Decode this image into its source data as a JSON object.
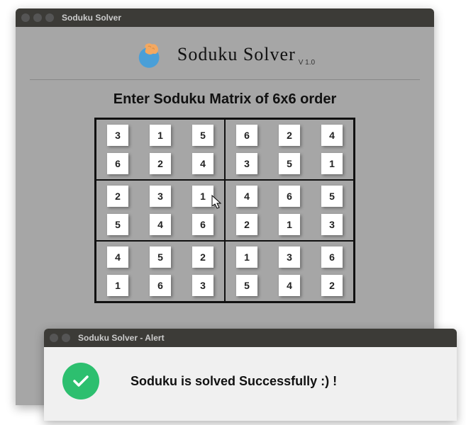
{
  "window": {
    "title": "Soduku Solver",
    "buttons": {
      "close": "#555",
      "min": "#555",
      "max": "#555"
    }
  },
  "header": {
    "title": "Soduku  Solver",
    "version": "V 1.0"
  },
  "prompt": "Enter Soduku Matrix of 6x6 order",
  "grid": [
    [
      "3",
      "1",
      "5",
      "6",
      "2",
      "4"
    ],
    [
      "6",
      "2",
      "4",
      "3",
      "5",
      "1"
    ],
    [
      "2",
      "3",
      "1",
      "4",
      "6",
      "5"
    ],
    [
      "5",
      "4",
      "6",
      "2",
      "1",
      "3"
    ],
    [
      "4",
      "5",
      "2",
      "1",
      "3",
      "6"
    ],
    [
      "1",
      "6",
      "3",
      "5",
      "4",
      "2"
    ]
  ],
  "alert": {
    "title": "Soduku Solver - Alert",
    "message": "Soduku is solved Successfully :) !"
  },
  "colors": {
    "success": "#2dbf6f",
    "titlebar": "#3c3b37",
    "appbg": "#a6a6a6"
  }
}
